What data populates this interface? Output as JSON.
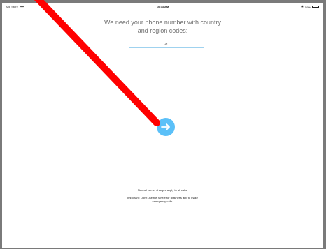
{
  "status_bar": {
    "carrier": "App Store",
    "time": "10:33 AM",
    "battery": "59%",
    "icons": [
      "wifi-icon",
      "bluetooth-icon",
      "battery-icon"
    ]
  },
  "prompt": {
    "line1": "We need your phone number with country",
    "line2": "and region codes:"
  },
  "phone_input": {
    "value": "+1"
  },
  "next_button": {
    "icon": "arrow-right-icon"
  },
  "footer": {
    "charges": "Normal carrier charges apply to all calls.",
    "important_line1": "Important: Don't use the Skype for Business app to make",
    "important_line2": "emergency calls."
  },
  "colors": {
    "accent": "#5bc0f8",
    "underline": "#9fd2ef",
    "annotation": "#ff0000"
  }
}
